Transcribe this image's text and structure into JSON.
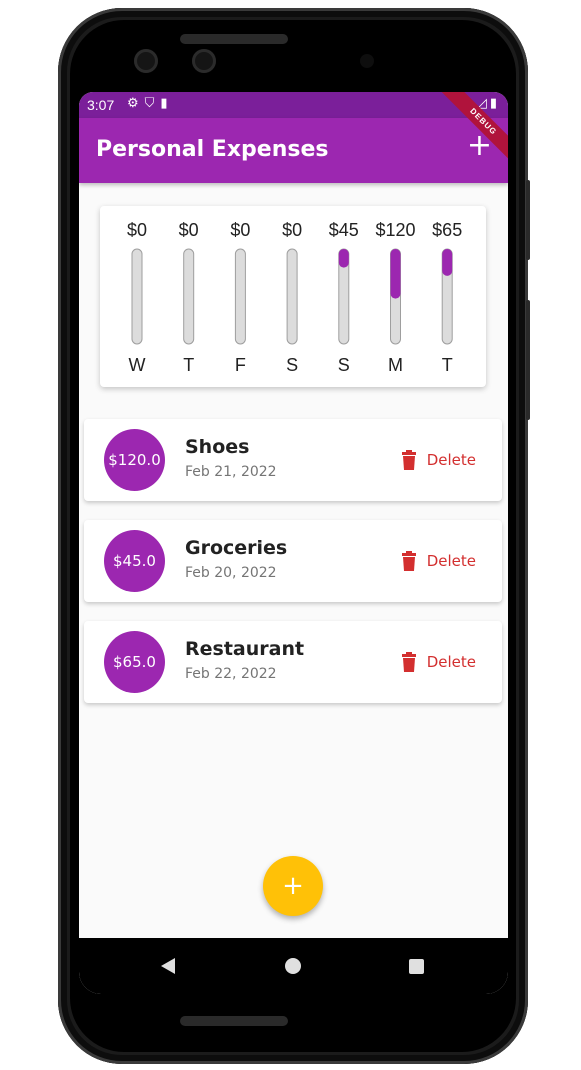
{
  "status_bar": {
    "time": "3:07",
    "left_icons": "⚙⛉▮",
    "right_icons": "▼◿▮",
    "debug_label": "DEBUG"
  },
  "app_bar": {
    "title": "Personal Expenses",
    "add_label": "+"
  },
  "colors": {
    "primary": "#9c27b0",
    "accent": "#ffc107",
    "delete": "#d32f2f",
    "status": "#7b1f9a"
  },
  "chart_data": {
    "type": "bar",
    "categories": [
      "W",
      "T",
      "F",
      "S",
      "S",
      "M",
      "T"
    ],
    "values": [
      0,
      0,
      0,
      0,
      45,
      120,
      65
    ],
    "value_labels": [
      "$0",
      "$0",
      "$0",
      "$0",
      "$45",
      "$120",
      "$65"
    ],
    "fill_fractions": [
      0,
      0,
      0,
      0,
      0.196,
      0.522,
      0.283
    ]
  },
  "transactions": [
    {
      "amount": "$120.0",
      "title": "Shoes",
      "date": "Feb 21, 2022",
      "delete_label": "Delete"
    },
    {
      "amount": "$45.0",
      "title": "Groceries",
      "date": "Feb 20, 2022",
      "delete_label": "Delete"
    },
    {
      "amount": "$65.0",
      "title": "Restaurant",
      "date": "Feb 22, 2022",
      "delete_label": "Delete"
    }
  ],
  "fab": {
    "label": "+"
  }
}
